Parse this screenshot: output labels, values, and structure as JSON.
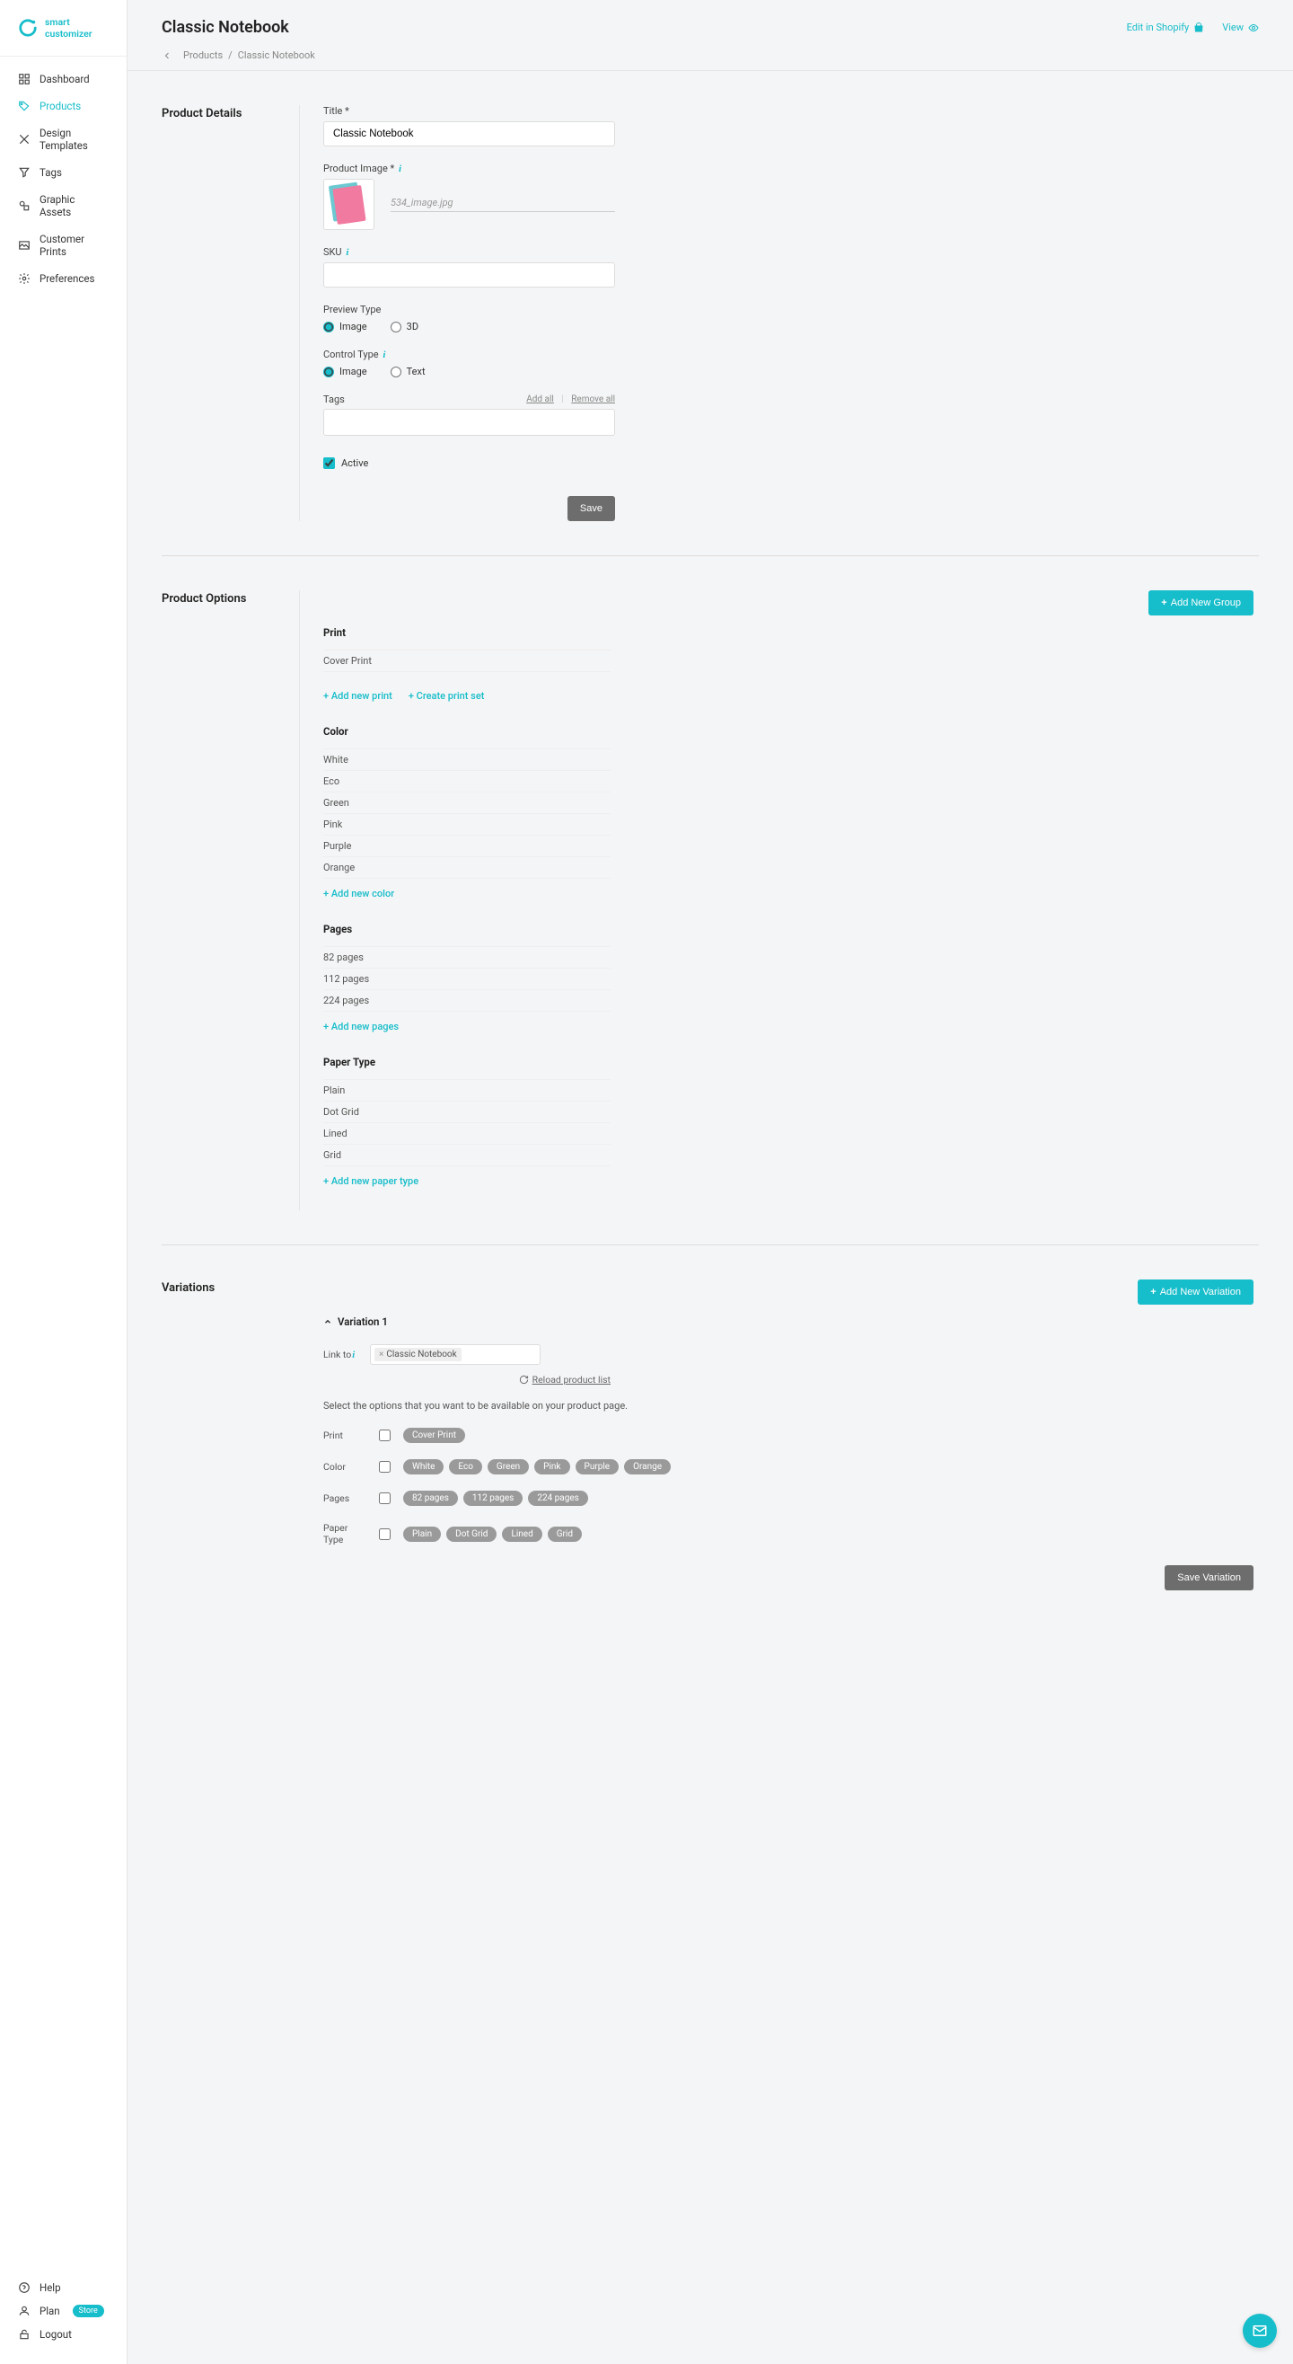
{
  "brand": {
    "name": "smart customizer"
  },
  "sidebar": {
    "items": [
      {
        "label": "Dashboard"
      },
      {
        "label": "Products"
      },
      {
        "label": "Design Templates"
      },
      {
        "label": "Tags"
      },
      {
        "label": "Graphic Assets"
      },
      {
        "label": "Customer Prints"
      },
      {
        "label": "Preferences"
      }
    ],
    "bottom": {
      "help": "Help",
      "plan": "Plan",
      "plan_badge": "Store",
      "logout": "Logout"
    }
  },
  "header": {
    "title": "Classic Notebook",
    "edit_link": "Edit in Shopify",
    "view_link": "View",
    "breadcrumb": {
      "products": "Products",
      "current": "Classic Notebook"
    }
  },
  "details": {
    "section_title": "Product Details",
    "title_label": "Title *",
    "title_value": "Classic Notebook",
    "image_label": "Product Image *",
    "image_filename": "534_image.jpg",
    "sku_label": "SKU",
    "sku_value": "",
    "preview_label": "Preview Type",
    "preview_image": "Image",
    "preview_3d": "3D",
    "control_label": "Control Type",
    "control_image": "Image",
    "control_text": "Text",
    "tags_label": "Tags",
    "add_all": "Add all",
    "remove_all": "Remove all",
    "active_label": "Active",
    "save_btn": "Save"
  },
  "options": {
    "section_title": "Product Options",
    "add_group_btn": "Add New Group",
    "print": {
      "title": "Print",
      "items": [
        "Cover Print"
      ],
      "add_new": "+ Add new print",
      "create_set": "+ Create print set"
    },
    "color": {
      "title": "Color",
      "items": [
        "White",
        "Eco",
        "Green",
        "Pink",
        "Purple",
        "Orange"
      ],
      "add_new": "+ Add new color"
    },
    "pages": {
      "title": "Pages",
      "items": [
        "82 pages",
        "112 pages",
        "224 pages"
      ],
      "add_new": "+ Add new pages"
    },
    "paper": {
      "title": "Paper Type",
      "items": [
        "Plain",
        "Dot Grid",
        "Lined",
        "Grid"
      ],
      "add_new": "+ Add new paper type"
    }
  },
  "variations": {
    "section_title": "Variations",
    "add_btn": "Add New Variation",
    "var1_title": "Variation 1",
    "link_to_label": "Link to",
    "link_to_chip": "Classic Notebook",
    "reload": "Reload product list",
    "instruction": "Select the options that you want to be available on your product page.",
    "rows": [
      {
        "label": "Print",
        "pills": [
          "Cover Print"
        ]
      },
      {
        "label": "Color",
        "pills": [
          "White",
          "Eco",
          "Green",
          "Pink",
          "Purple",
          "Orange"
        ]
      },
      {
        "label": "Pages",
        "pills": [
          "82 pages",
          "112 pages",
          "224 pages"
        ]
      },
      {
        "label": "Paper Type",
        "pills": [
          "Plain",
          "Dot Grid",
          "Lined",
          "Grid"
        ]
      }
    ],
    "save_btn": "Save Variation"
  }
}
